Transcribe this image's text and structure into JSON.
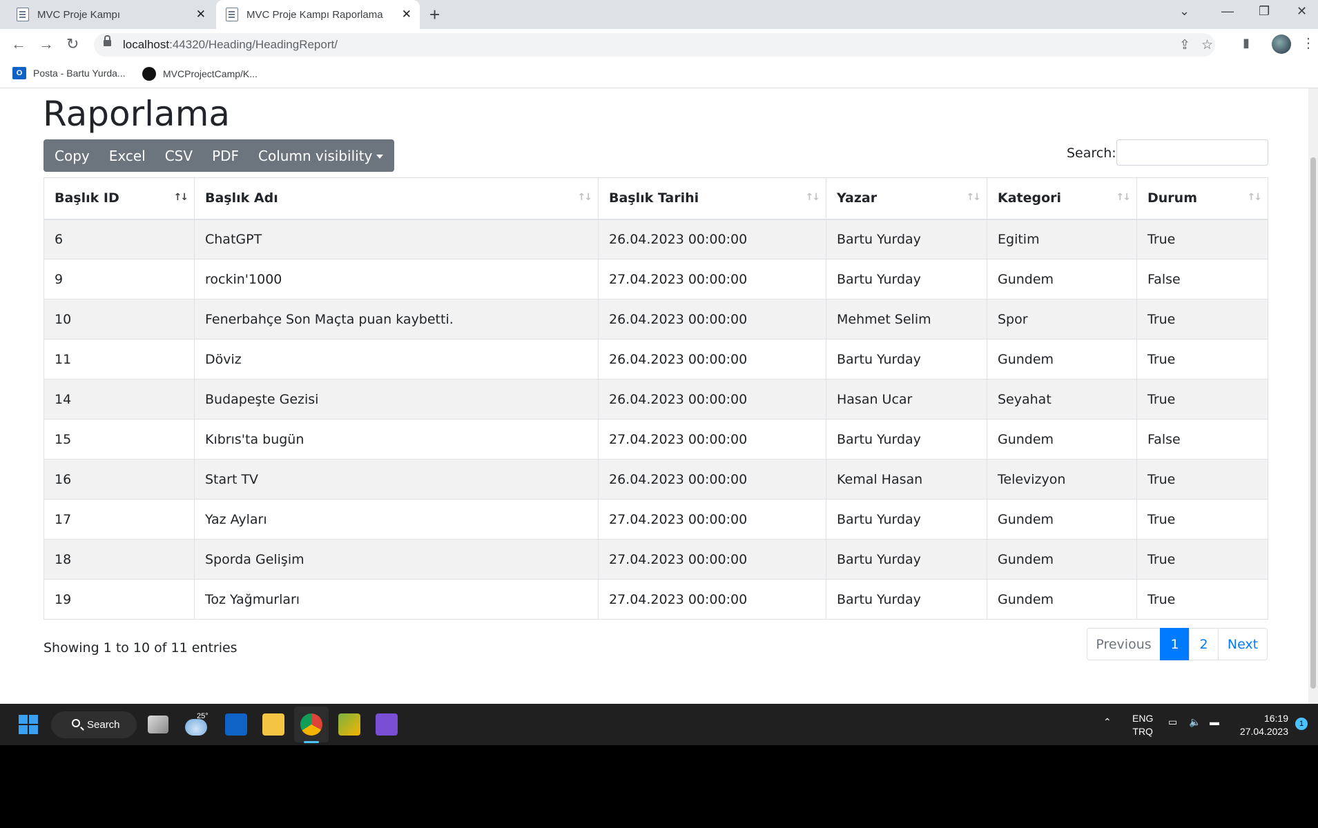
{
  "browser": {
    "tabs": [
      {
        "title": "MVC Proje Kampı"
      },
      {
        "title": "MVC Proje Kampı Raporlama"
      }
    ],
    "url_host": "localhost",
    "url_rest": ":44320/Heading/HeadingReport/",
    "bookmarks": [
      {
        "label": "Posta - Bartu Yurda...",
        "icon": "outlook-icon"
      },
      {
        "label": "MVCProjectCamp/K...",
        "icon": "github-icon"
      }
    ]
  },
  "page": {
    "title": "Raporlama",
    "buttons": {
      "copy": "Copy",
      "excel": "Excel",
      "csv": "CSV",
      "pdf": "PDF",
      "colvis": "Column visibility"
    },
    "search_label": "Search:",
    "search_value": "",
    "table": {
      "columns": [
        "Başlık ID",
        "Başlık Adı",
        "Başlık Tarihi",
        "Yazar",
        "Kategori",
        "Durum"
      ],
      "rows": [
        [
          "6",
          "ChatGPT",
          "26.04.2023 00:00:00",
          "Bartu Yurday",
          "Egitim",
          "True"
        ],
        [
          "9",
          "rockin'1000",
          "27.04.2023 00:00:00",
          "Bartu Yurday",
          "Gundem",
          "False"
        ],
        [
          "10",
          "Fenerbahçe Son Maçta puan kaybetti.",
          "26.04.2023 00:00:00",
          "Mehmet Selim",
          "Spor",
          "True"
        ],
        [
          "11",
          "Döviz",
          "26.04.2023 00:00:00",
          "Bartu Yurday",
          "Gundem",
          "True"
        ],
        [
          "14",
          "Budapeşte Gezisi",
          "26.04.2023 00:00:00",
          "Hasan Ucar",
          "Seyahat",
          "True"
        ],
        [
          "15",
          "Kıbrıs'ta bugün",
          "27.04.2023 00:00:00",
          "Bartu Yurday",
          "Gundem",
          "False"
        ],
        [
          "16",
          "Start TV",
          "26.04.2023 00:00:00",
          "Kemal Hasan",
          "Televizyon",
          "True"
        ],
        [
          "17",
          "Yaz Ayları",
          "27.04.2023 00:00:00",
          "Bartu Yurday",
          "Gundem",
          "True"
        ],
        [
          "18",
          "Sporda Gelişim",
          "27.04.2023 00:00:00",
          "Bartu Yurday",
          "Gundem",
          "True"
        ],
        [
          "19",
          "Toz Yağmurları",
          "27.04.2023 00:00:00",
          "Bartu Yurday",
          "Gundem",
          "True"
        ]
      ]
    },
    "info": "Showing 1 to 10 of 11 entries",
    "pagination": {
      "previous": "Previous",
      "pages": [
        "1",
        "2"
      ],
      "active": "1",
      "next": "Next"
    }
  },
  "taskbar": {
    "search": "Search",
    "weather_temp": "25°",
    "lang_line1": "ENG",
    "lang_line2": "TRQ",
    "time": "16:19",
    "date": "27.04.2023",
    "notifications": "1"
  },
  "colors": {
    "accent": "#007bff",
    "button_group": "#6c757d"
  }
}
